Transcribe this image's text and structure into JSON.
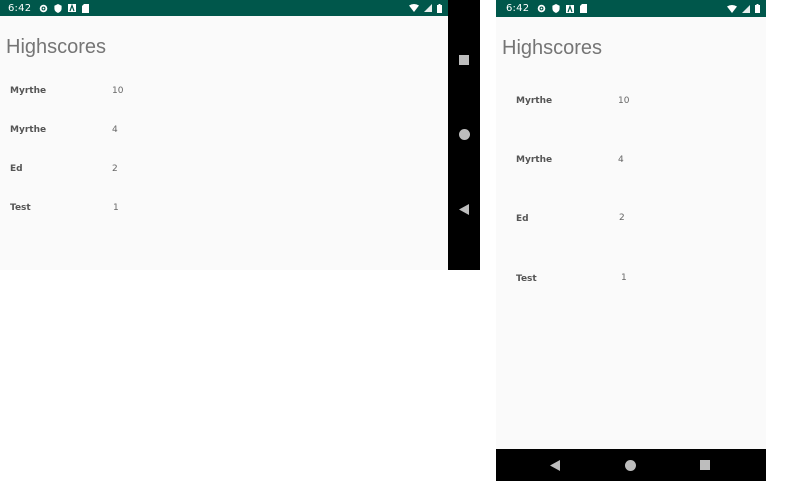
{
  "status_bar": {
    "time": "6:42",
    "icons_left": [
      "gear-icon",
      "shield-icon",
      "font-icon",
      "sd-card-icon"
    ],
    "icons_right": [
      "wifi-icon",
      "signal-icon",
      "battery-icon"
    ],
    "background_color": "#00574b"
  },
  "screens": [
    {
      "orientation": "landscape",
      "title": "Highscores",
      "scores": [
        {
          "name": "Myrthe",
          "score": "10"
        },
        {
          "name": "Myrthe",
          "score": "4"
        },
        {
          "name": "Ed",
          "score": "2"
        },
        {
          "name": "Test",
          "score": "1"
        }
      ],
      "nav_buttons": [
        "recents-square-icon",
        "home-circle-icon",
        "back-triangle-icon"
      ]
    },
    {
      "orientation": "portrait",
      "title": "Highscores",
      "scores": [
        {
          "name": "Myrthe",
          "score": "10"
        },
        {
          "name": "Myrthe",
          "score": "4"
        },
        {
          "name": "Ed",
          "score": "2"
        },
        {
          "name": "Test",
          "score": "1"
        }
      ],
      "nav_buttons": [
        "back-triangle-icon",
        "home-circle-icon",
        "recents-square-icon"
      ]
    }
  ]
}
